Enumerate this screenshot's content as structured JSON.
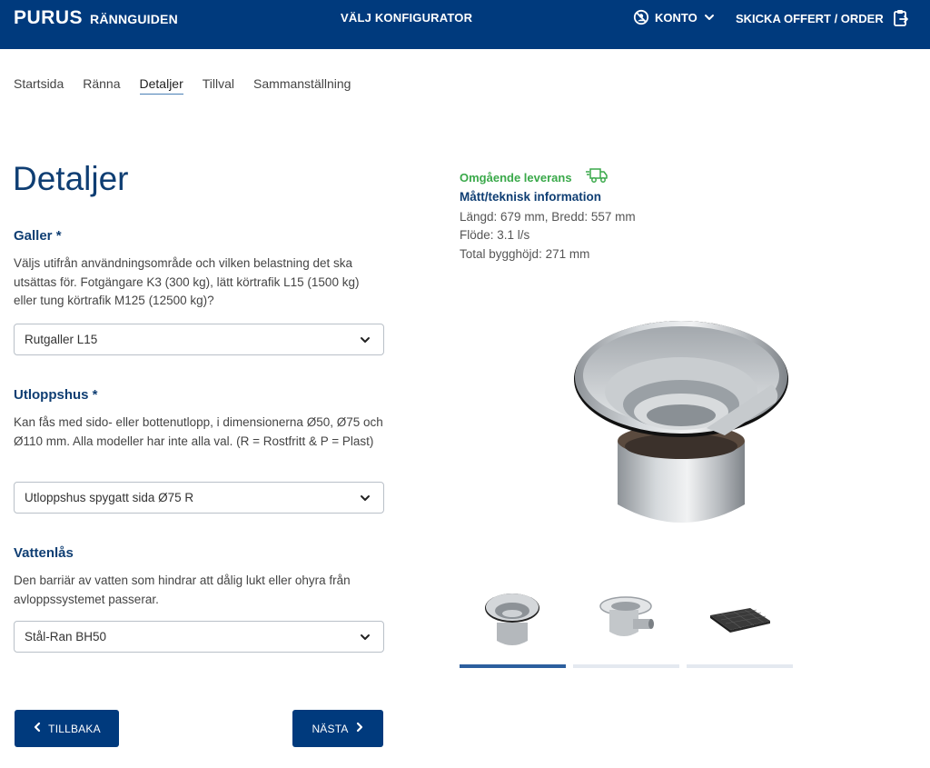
{
  "header": {
    "brand_logo": "PURUS",
    "brand_sub": "RÄNNGUIDEN",
    "configurator": "VÄLJ KONFIGURATOR",
    "account": "KONTO",
    "order": "SKICKA OFFERT / ORDER"
  },
  "breadcrumb": [
    "Startsida",
    "Ränna",
    "Detaljer",
    "Tillval",
    "Sammanställning"
  ],
  "breadcrumb_active": "Detaljer",
  "page_title": "Detaljer",
  "galler": {
    "heading": "Galler *",
    "description": "Väljs utifrån användningsområde och vilken belastning det ska utsättas för. Fotgängare K3 (300 kg), lätt körtrafik L15 (1500 kg) eller tung körtrafik M125 (12500 kg)?",
    "selected": "Rutgaller L15"
  },
  "utloppshus": {
    "heading": "Utloppshus *",
    "description": "Kan fås med sido- eller bottenutlopp, i dimensionerna Ø50, Ø75 och Ø110 mm. Alla modeller har inte alla val. (R = Rostfritt & P = Plast)",
    "selected": "Utloppshus spygatt sida Ø75 R"
  },
  "vattenlas": {
    "heading": "Vattenlås",
    "description": "Den barriär av vatten som hindrar att dålig lukt eller ohyra från avloppssystemet passerar.",
    "selected": "Stål-Ran BH50"
  },
  "buttons": {
    "back": "TILLBAKA",
    "next": "NÄSTA"
  },
  "info": {
    "delivery": "Omgående leverans",
    "tech_title": "Mått/teknisk information",
    "dimensions": "Längd: 679 mm, Bredd: 557 mm",
    "flow": "Flöde: 3.1 l/s",
    "height": "Total bygghöjd: 271 mm"
  },
  "colors": {
    "brand_navy": "#003a7d",
    "heading_blue": "#0f3e73",
    "delivery_green": "#3aa94a"
  },
  "icons": [
    "no-access-icon",
    "chevron-down-icon",
    "clipboard-export-icon",
    "delivery-truck-icon",
    "chevron-left-icon",
    "chevron-right-icon"
  ]
}
